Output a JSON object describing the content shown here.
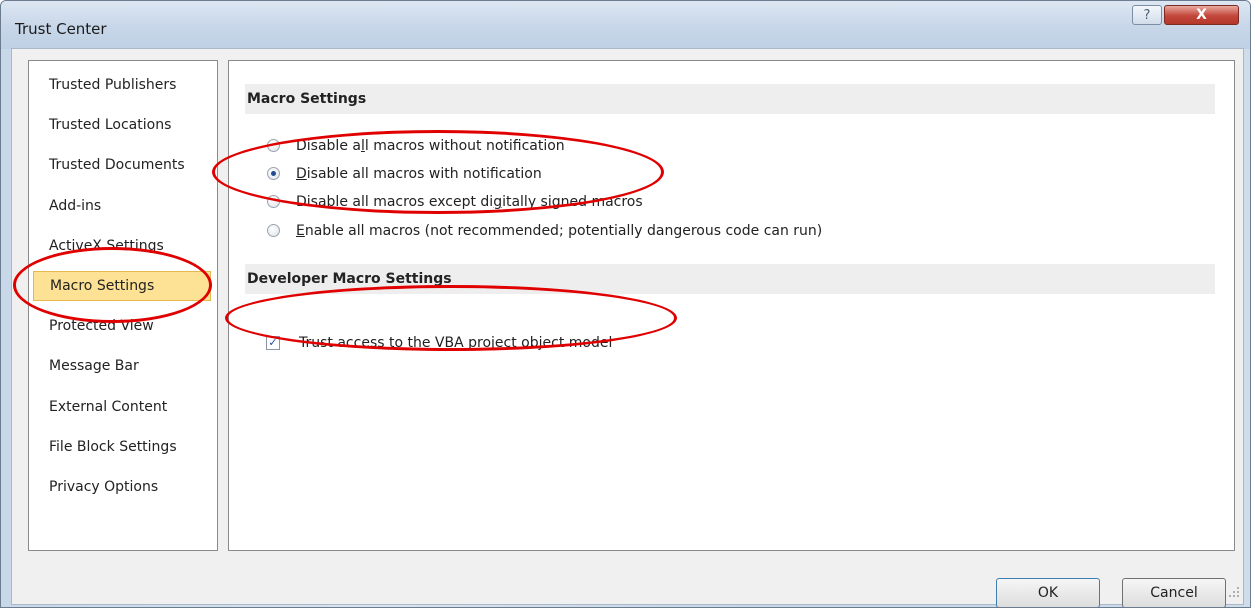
{
  "window": {
    "title": "Trust Center",
    "help_label": "?",
    "close_label": "X"
  },
  "nav": {
    "items": [
      {
        "label": "Trusted Publishers",
        "selected": false
      },
      {
        "label": "Trusted Locations",
        "selected": false
      },
      {
        "label": "Trusted Documents",
        "selected": false
      },
      {
        "label": "Add-ins",
        "selected": false
      },
      {
        "label": "ActiveX Settings",
        "selected": false
      },
      {
        "label": "Macro Settings",
        "selected": true
      },
      {
        "label": "Protected View",
        "selected": false
      },
      {
        "label": "Message Bar",
        "selected": false
      },
      {
        "label": "External Content",
        "selected": false
      },
      {
        "label": "File Block Settings",
        "selected": false
      },
      {
        "label": "Privacy Options",
        "selected": false
      }
    ]
  },
  "macro_settings": {
    "heading": "Macro Settings",
    "options": [
      {
        "prefix": "Disable a",
        "accel": "l",
        "suffix": "l macros without notification",
        "checked": false
      },
      {
        "prefix": "",
        "accel": "D",
        "suffix": "isable all macros with notification",
        "checked": true
      },
      {
        "prefix": "Disable all macros except di",
        "accel": "g",
        "suffix": "itally signed macros",
        "checked": false
      },
      {
        "prefix": "",
        "accel": "E",
        "suffix": "nable all macros (not recommended; potentially dangerous code can run)",
        "checked": false
      }
    ]
  },
  "developer_settings": {
    "heading": "Developer Macro Settings",
    "trust_vba": {
      "prefix": "Trust access to the ",
      "accel": "V",
      "suffix": "BA project object model",
      "checked": true,
      "check_glyph": "✓"
    }
  },
  "buttons": {
    "ok": "OK",
    "cancel": "Cancel"
  },
  "colors": {
    "annotation": "#e00000",
    "selection": "#fde295"
  }
}
